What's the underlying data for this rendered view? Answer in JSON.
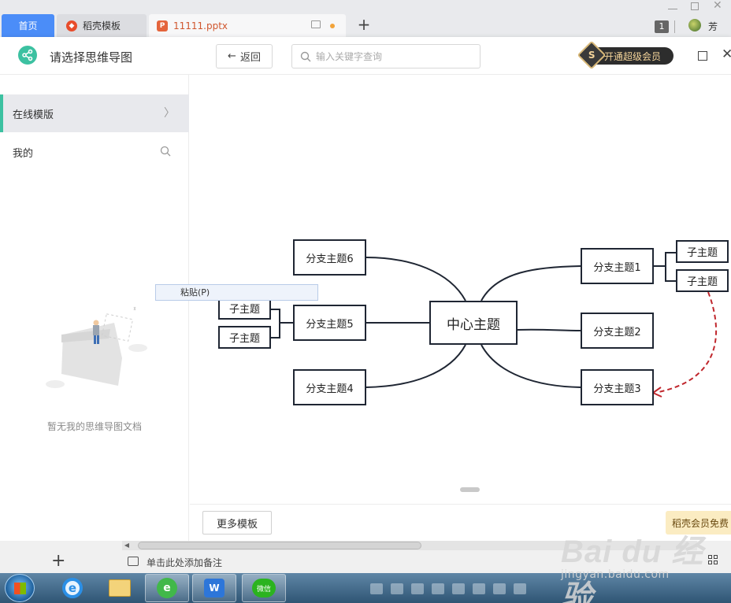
{
  "tabs": {
    "home": "首页",
    "template": "稻壳模板",
    "file": "11111.pptx",
    "file_icon": "P",
    "new_tab": "+"
  },
  "titlebar": {
    "window_count": "1",
    "user_name": "芳"
  },
  "dialog": {
    "title": "请选择思维导图",
    "back_label": "返回",
    "search_placeholder": "输入关键字查询",
    "vip_label": "开通超级会员",
    "vip_icon_letter": "S"
  },
  "sidebar": {
    "online_templates": "在线模版",
    "mine": "我的",
    "empty_text": "暂无我的思维导图文档"
  },
  "mindmap": {
    "center": "中心主题",
    "branches_right": [
      "分支主题1",
      "分支主题2",
      "分支主题3"
    ],
    "branches_left": [
      "分支主题6",
      "分支主题5",
      "分支主题4"
    ],
    "subtopics_right": [
      "子主题",
      "子主题"
    ],
    "subtopics_left": [
      "子主题",
      "子主题"
    ],
    "line_color": "#1f2633",
    "arrow_color": "#c0272d"
  },
  "context_menu": {
    "paste": "粘贴(P)"
  },
  "footer": {
    "more_templates": "更多模板",
    "promo": "稻壳会员免费"
  },
  "wps": {
    "notes_placeholder": "单击此处添加备注",
    "add_slide": "+"
  },
  "taskbar": {
    "ie_letter": "e",
    "browser_letter": "e",
    "wps_letter": "W",
    "wechat_label": "微信"
  },
  "watermark": {
    "brand": "Bai du 经验",
    "url": "jingyan.baidu.com"
  },
  "colors": {
    "accent": "#3cc1a1",
    "home_tab": "#4b8df8",
    "vip_gold": "#f4d49a"
  }
}
